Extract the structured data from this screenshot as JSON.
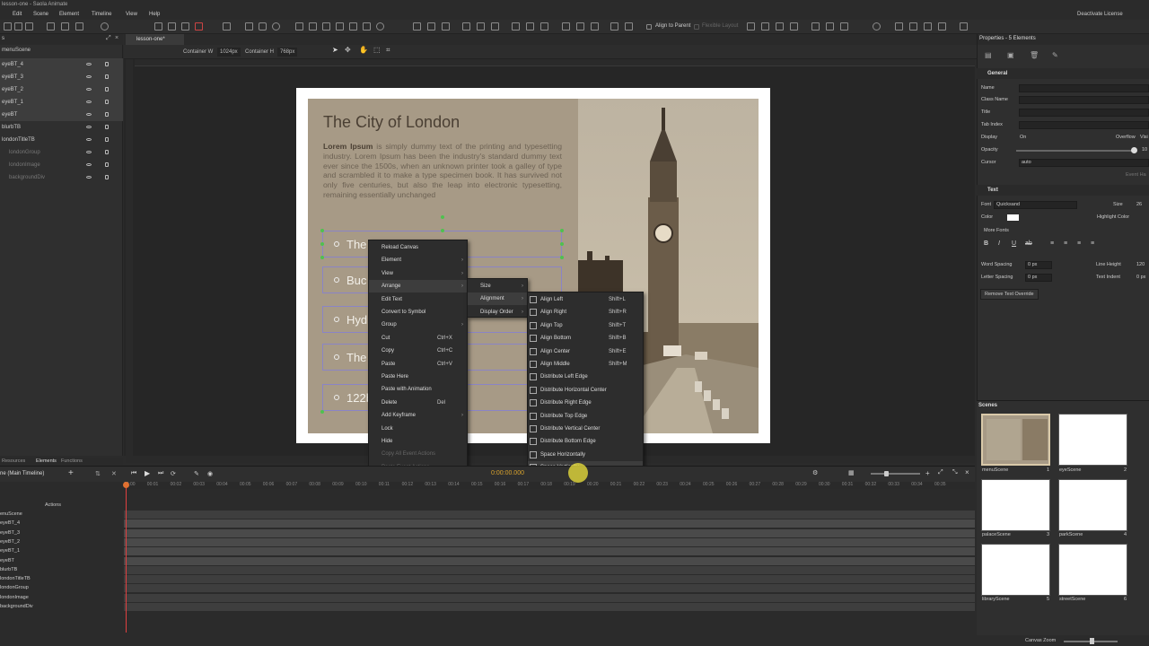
{
  "app": {
    "title": "lesson-one - Saola Animate",
    "deactivate_license": "Deactivate License"
  },
  "menubar": [
    "Edit",
    "Scene",
    "Element",
    "Timeline",
    "View",
    "Help"
  ],
  "toolbar": {
    "align_to_parent": "Align to Parent",
    "flexible_layout": "Flexible Layout"
  },
  "document_tab": {
    "label": "lesson-one*"
  },
  "container": {
    "width_label": "Container W",
    "width_value": "1024px",
    "height_label": "Container H",
    "height_value": "768px"
  },
  "left_panel": {
    "rows": [
      {
        "label": "eyeBT_4",
        "sel": true
      },
      {
        "label": "eyeBT_3",
        "sel": true
      },
      {
        "label": "eyeBT_2",
        "sel": true
      },
      {
        "label": "eyeBT_1",
        "sel": true
      },
      {
        "label": "eyeBT",
        "sel": true
      },
      {
        "label": "blurbTB",
        "sel": false
      },
      {
        "label": "londonTitleTB",
        "sel": false
      },
      {
        "label": "londonGroup",
        "sel": false,
        "dim": true
      },
      {
        "label": "londonImage",
        "sel": false,
        "dim": true
      },
      {
        "label": "backgroundDiv",
        "sel": false,
        "dim": true
      }
    ],
    "header": "menuScene",
    "tabs": [
      "Resources",
      "Elements",
      "Functions"
    ]
  },
  "canvas": {
    "title": "The City of London",
    "blurb_bold": "Lorem Ipsum",
    "blurb": " is simply dummy text of the printing and typesetting industry. Lorem Ipsum has been the industry's standard dummy text ever since the 1500s, when an unknown printer took a galley of type and scrambled it to make a type specimen book. It has survived not only five centuries, but also the leap into electronic typesetting, remaining essentially unchanged",
    "buttons": [
      "The",
      "Buc",
      "Hyd",
      "The",
      "122b"
    ]
  },
  "context_menu": {
    "items": [
      {
        "label": "Reload Canvas"
      },
      {
        "label": "Element",
        "sub": true
      },
      {
        "label": "View",
        "sub": true
      },
      {
        "label": "Arrange",
        "sub": true,
        "hl": true
      },
      {
        "label": "Edit Text"
      },
      {
        "label": "Convert to Symbol"
      },
      {
        "label": "Group",
        "sub": true
      },
      {
        "label": "Cut",
        "sc": "Ctrl+X"
      },
      {
        "label": "Copy",
        "sc": "Ctrl+C"
      },
      {
        "label": "Paste",
        "sc": "Ctrl+V"
      },
      {
        "label": "Paste Here"
      },
      {
        "label": "Paste with Animation"
      },
      {
        "label": "Delete",
        "sc": "Del"
      },
      {
        "label": "Add Keyframe",
        "sub": true
      },
      {
        "label": "Lock"
      },
      {
        "label": "Hide"
      },
      {
        "label": "Copy All Event Actions",
        "dis": true
      },
      {
        "label": "Paste Event Actions",
        "dis": true
      },
      {
        "label": "Event Handlers",
        "dis": true
      }
    ]
  },
  "arrange_menu": {
    "items": [
      {
        "label": "Size",
        "sub": true
      },
      {
        "label": "Alignment",
        "sub": true,
        "hl": true
      },
      {
        "label": "Display Order",
        "sub": true
      }
    ]
  },
  "alignment_menu": {
    "items": [
      {
        "label": "Align Left",
        "sc": "Shift+L"
      },
      {
        "label": "Align Right",
        "sc": "Shift+R"
      },
      {
        "label": "Align Top",
        "sc": "Shift+T"
      },
      {
        "label": "Align Bottom",
        "sc": "Shift+B"
      },
      {
        "label": "Align Center",
        "sc": "Shift+E"
      },
      {
        "label": "Align Middle",
        "sc": "Shift+M"
      },
      {
        "label": "Distribute Left Edge"
      },
      {
        "label": "Distribute Horizontal Center"
      },
      {
        "label": "Distribute Right Edge"
      },
      {
        "label": "Distribute Top Edge"
      },
      {
        "label": "Distribute Vertical Center"
      },
      {
        "label": "Distribute Bottom Edge"
      },
      {
        "label": "Space Horizontally"
      },
      {
        "label": "Space Vertically",
        "hl": true
      }
    ]
  },
  "timeline": {
    "title": "ne (Main Timeline)",
    "time": "0:00:00.000",
    "actions_label": "Actions",
    "ticks": [
      "00:00",
      "00:01",
      "00:02",
      "00:03",
      "00:04",
      "00:05",
      "00:06",
      "00:07",
      "00:08",
      "00:09",
      "00:10",
      "00:11",
      "00:12",
      "00:13",
      "00:14",
      "00:15",
      "00:16",
      "00:17",
      "00:18",
      "00:19",
      "00:20",
      "00:21",
      "00:22",
      "00:23",
      "00:24",
      "00:25",
      "00:26",
      "00:27",
      "00:28",
      "00:29",
      "00:30",
      "00:31",
      "00:32",
      "00:33",
      "00:34",
      "00:35"
    ],
    "rows": [
      {
        "label": "enuScene",
        "sel": false
      },
      {
        "label": "eyeBT_4",
        "sel": true
      },
      {
        "label": "eyeBT_3",
        "sel": true
      },
      {
        "label": "eyeBT_2",
        "sel": true
      },
      {
        "label": "eyeBT_1",
        "sel": true
      },
      {
        "label": "eyeBT",
        "sel": true
      },
      {
        "label": "blurbTB",
        "sel": false
      },
      {
        "label": "londonTitleTB",
        "sel": false
      },
      {
        "label": "londonGroup",
        "sel": false
      },
      {
        "label": "londonImage",
        "sel": false
      },
      {
        "label": "backgroundDiv",
        "sel": false
      }
    ]
  },
  "properties": {
    "title": "Properties - 5 Elements",
    "general": "General",
    "fields": {
      "name": "Name",
      "class_name": "Class Name",
      "title": "Title",
      "tab_index": "Tab Index",
      "display": "Display",
      "display_value": "On",
      "overflow": "Overflow",
      "overflow_value": "Visi",
      "opacity": "Opacity",
      "opacity_value": "10",
      "cursor": "Cursor",
      "cursor_value": "auto",
      "event_handlers": "Event Ha"
    },
    "text": "Text",
    "font_label": "Font",
    "font_value": "Quicksand",
    "size_label": "Size",
    "size_value": "26",
    "color_label": "Color",
    "highlight_label": "Highlight Color",
    "more_fonts": "More Fonts",
    "word_spacing": "Word Spacing",
    "word_spacing_value": "0 px",
    "letter_spacing": "Letter Spacing",
    "letter_spacing_value": "0 px",
    "line_height": "Line Height",
    "line_height_value": "120",
    "text_indent": "Text Indent",
    "text_indent_value": "0 px",
    "remove_override": "Remove Text Override"
  },
  "scenes": {
    "header": "Scenes",
    "items": [
      {
        "name": "menuScene",
        "num": "1"
      },
      {
        "name": "eyeScene",
        "num": "2"
      },
      {
        "name": "palaceScene",
        "num": "3"
      },
      {
        "name": "parkScene",
        "num": "4"
      },
      {
        "name": "libraryScene",
        "num": "5"
      },
      {
        "name": "streetScene",
        "num": "6"
      }
    ]
  },
  "status": {
    "canvas_zoom": "Canvas Zoom"
  }
}
